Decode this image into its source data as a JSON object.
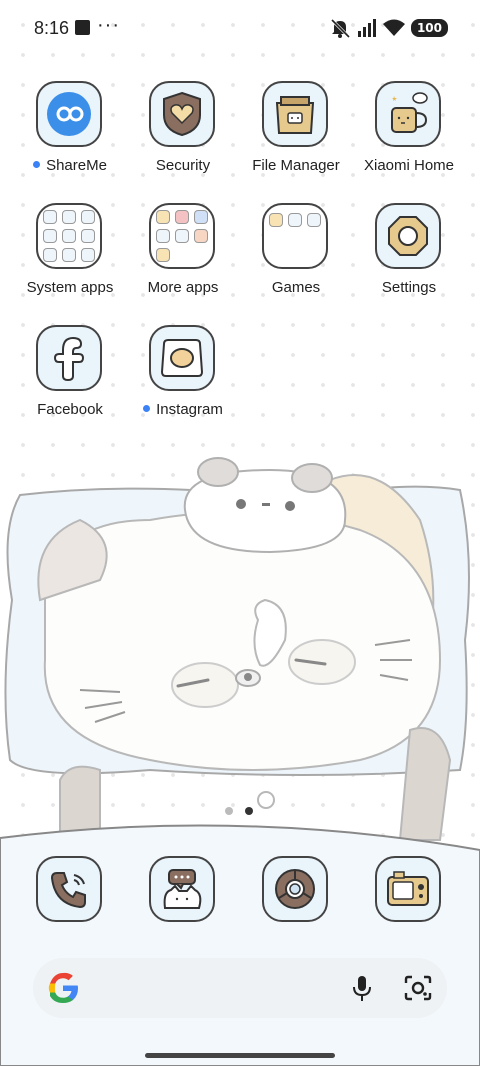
{
  "status_bar": {
    "time": "8:16",
    "battery": "100"
  },
  "apps": [
    {
      "label": "ShareMe",
      "icon": "shareme-icon",
      "new": true
    },
    {
      "label": "Security",
      "icon": "shield-heart-icon",
      "new": false
    },
    {
      "label": "File Manager",
      "icon": "folder-bag-icon",
      "new": false
    },
    {
      "label": "Xiaomi Home",
      "icon": "coffee-mug-icon",
      "new": false
    },
    {
      "label": "System apps",
      "icon": "folder-icon",
      "new": false
    },
    {
      "label": "More apps",
      "icon": "folder-icon",
      "new": false
    },
    {
      "label": "Games",
      "icon": "folder-icon",
      "new": false
    },
    {
      "label": "Settings",
      "icon": "gear-icon",
      "new": false
    },
    {
      "label": "Facebook",
      "icon": "facebook-icon",
      "new": false
    },
    {
      "label": "Instagram",
      "icon": "instagram-icon",
      "new": true
    }
  ],
  "dock": [
    {
      "icon": "phone-icon"
    },
    {
      "icon": "messages-icon"
    },
    {
      "icon": "chrome-icon"
    },
    {
      "icon": "camera-icon"
    }
  ],
  "page_indicator": {
    "pages": 2,
    "current": 2
  },
  "colors": {
    "accent": "#3b82f6",
    "icon_bg": "#e9f4fb",
    "outline": "#444444"
  }
}
